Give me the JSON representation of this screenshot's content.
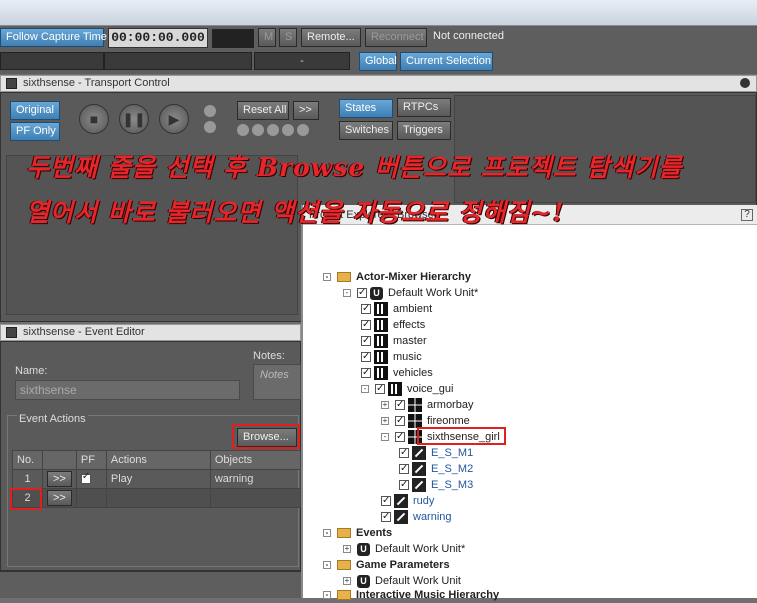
{
  "toolbar": {
    "follow_capture": "Follow Capture Time",
    "timecode": "00:00:00.000",
    "mute": "M",
    "solo": "S",
    "remote": "Remote...",
    "reconnect": "Reconnect",
    "status": "Not connected",
    "dash": "-",
    "global": "Global",
    "current_selection": "Current Selection"
  },
  "transport": {
    "title": "sixthsense - Transport Control",
    "original": "Original",
    "pf_only": "PF Only",
    "reset_all": "Reset All",
    "more": ">>",
    "states": "States",
    "rtpcs": "RTPCs",
    "switches": "Switches",
    "triggers": "Triggers"
  },
  "annotation": {
    "line1": "두번째 줄을 선택 후 Browse 버튼으로 프로젝트 탐색기를",
    "line2": "열어서 바로 불러오면 액션을 자동으로 정해짐~!"
  },
  "event_editor": {
    "title": "sixthsense - Event Editor",
    "name_label": "Name:",
    "name_value": "sixthsense",
    "notes_label": "Notes:",
    "notes_placeholder": "Notes",
    "actions_label": "Event Actions",
    "browse": "Browse...",
    "columns": [
      "No.",
      "",
      "PF",
      "Actions",
      "Objects"
    ],
    "rows": [
      {
        "no": "1",
        "btn": ">>",
        "pf": true,
        "action": "Play",
        "object": "warning"
      },
      {
        "no": "2",
        "btn": ">>",
        "pf": false,
        "action": "",
        "object": ""
      }
    ]
  },
  "explorer": {
    "title": "Project Explorer - Browser",
    "help": "?",
    "tree": [
      {
        "label": "Actor-Mixer Hierarchy",
        "type": "folder",
        "bold": true
      },
      {
        "label": "Default Work Unit*",
        "type": "wu"
      },
      {
        "label": "ambient",
        "type": "actor"
      },
      {
        "label": "effects",
        "type": "actor"
      },
      {
        "label": "master",
        "type": "actor"
      },
      {
        "label": "music",
        "type": "actor"
      },
      {
        "label": "vehicles",
        "type": "actor"
      },
      {
        "label": "voice_gui",
        "type": "actor"
      },
      {
        "label": "armorbay",
        "type": "rand"
      },
      {
        "label": "fireonme",
        "type": "rand"
      },
      {
        "label": "sixthsense_girl",
        "type": "rand"
      },
      {
        "label": "E_S_M1",
        "type": "sound",
        "link": true
      },
      {
        "label": "E_S_M2",
        "type": "sound",
        "link": true
      },
      {
        "label": "E_S_M3",
        "type": "sound",
        "link": true
      },
      {
        "label": "rudy",
        "type": "sound",
        "link": true
      },
      {
        "label": "warning",
        "type": "sound",
        "link": true
      },
      {
        "label": "Events",
        "type": "folder",
        "bold": true
      },
      {
        "label": "Default Work Unit*",
        "type": "wu"
      },
      {
        "label": "Game Parameters",
        "type": "folder",
        "bold": true
      },
      {
        "label": "Default Work Unit",
        "type": "wu"
      },
      {
        "label": "Interactive Music Hierarchy",
        "type": "folder",
        "bold": true
      }
    ]
  },
  "colors": {
    "accent_blue": "#4f8fc4",
    "highlight_red": "#e02020",
    "panel_gray": "#5a5a5a"
  }
}
